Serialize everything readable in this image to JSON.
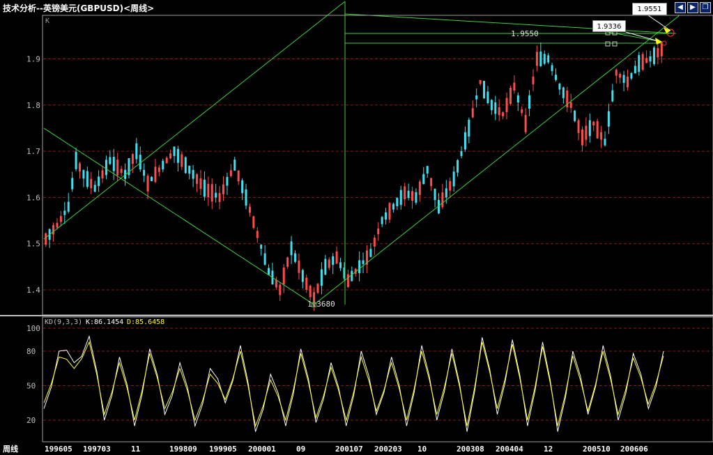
{
  "window": {
    "title": "技术分析--英镑美元(GBPUSD)<周线>"
  },
  "toolbar": {
    "prev_icon": "left-arrow-icon",
    "next_icon": "right-arrow-icon",
    "restore_icon": "restore-window-icon"
  },
  "colors": {
    "up": "#ff4d4d",
    "down": "#40e0f0",
    "trend": "#3fd23f",
    "grid": "#8b1a1a",
    "k_line": "#ffffff",
    "d_line": "#ffff33",
    "axis_text": "#c0c0c0"
  },
  "main_panel": {
    "label": "K"
  },
  "kd_panel": {
    "label": "KD(9,3,3)",
    "k_text": "K:86.1454",
    "d_text": "D:85.6458"
  },
  "annotations": {
    "low_price": "1.3680",
    "high_price": "1.9550",
    "callout_top": "1.9551",
    "callout_mid": "1.9336"
  },
  "period_label": "周线",
  "chart_data": [
    {
      "type": "candlestick",
      "title": "技术分析--英镑美元(GBPUSD)<周线>",
      "ylim": [
        1.34,
        1.99
      ],
      "yticks": [
        "1.4",
        "1.5",
        "1.6",
        "1.7",
        "1.8",
        "1.9"
      ],
      "xticks": [
        "199605",
        "199703",
        "11",
        "199809",
        "199905",
        "200001",
        "09",
        "200107",
        "200203",
        "10",
        "200308",
        "200404",
        "12",
        "200510",
        "200606"
      ],
      "grid": true,
      "close_path": [
        [
          0,
          1.51
        ],
        [
          3,
          1.54
        ],
        [
          6,
          1.58
        ],
        [
          8,
          1.68
        ],
        [
          10,
          1.65
        ],
        [
          13,
          1.62
        ],
        [
          17,
          1.68
        ],
        [
          21,
          1.65
        ],
        [
          24,
          1.7
        ],
        [
          27,
          1.63
        ],
        [
          30,
          1.66
        ],
        [
          34,
          1.7
        ],
        [
          38,
          1.66
        ],
        [
          42,
          1.62
        ],
        [
          46,
          1.6
        ],
        [
          50,
          1.67
        ],
        [
          53,
          1.6
        ],
        [
          56,
          1.52
        ],
        [
          59,
          1.44
        ],
        [
          62,
          1.4
        ],
        [
          65,
          1.49
        ],
        [
          68,
          1.43
        ],
        [
          71,
          1.38
        ],
        [
          74,
          1.45
        ],
        [
          77,
          1.47
        ],
        [
          80,
          1.42
        ],
        [
          83,
          1.45
        ],
        [
          86,
          1.48
        ],
        [
          89,
          1.55
        ],
        [
          92,
          1.58
        ],
        [
          95,
          1.61
        ],
        [
          98,
          1.6
        ],
        [
          101,
          1.66
        ],
        [
          104,
          1.58
        ],
        [
          108,
          1.64
        ],
        [
          112,
          1.75
        ],
        [
          115,
          1.85
        ],
        [
          118,
          1.8
        ],
        [
          121,
          1.78
        ],
        [
          124,
          1.84
        ],
        [
          127,
          1.76
        ],
        [
          130,
          1.9
        ],
        [
          133,
          1.9
        ],
        [
          136,
          1.84
        ],
        [
          139,
          1.8
        ],
        [
          142,
          1.73
        ],
        [
          145,
          1.76
        ],
        [
          148,
          1.72
        ],
        [
          151,
          1.87
        ],
        [
          154,
          1.85
        ],
        [
          157,
          1.89
        ],
        [
          160,
          1.9
        ],
        [
          163,
          1.92
        ]
      ]
    },
    {
      "type": "line",
      "ylim": [
        0,
        100
      ],
      "yticks": [
        "20",
        "50",
        "80",
        "100"
      ],
      "series": [
        {
          "name": "K",
          "swings": [
            30,
            80,
            70,
            93,
            20,
            75,
            15,
            82,
            25,
            70,
            15,
            65,
            35,
            85,
            10,
            60,
            15,
            82,
            18,
            70,
            15,
            80,
            25,
            75,
            15,
            85,
            20,
            82,
            10,
            92,
            25,
            90,
            15,
            88,
            10,
            80,
            25,
            85,
            20,
            78,
            30,
            80
          ]
        },
        {
          "name": "D",
          "swings": [
            35,
            75,
            65,
            88,
            25,
            70,
            20,
            78,
            30,
            65,
            20,
            60,
            38,
            80,
            15,
            55,
            20,
            78,
            22,
            66,
            20,
            75,
            28,
            70,
            20,
            80,
            25,
            78,
            15,
            88,
            30,
            86,
            20,
            84,
            15,
            76,
            28,
            80,
            25,
            74,
            34,
            76
          ]
        }
      ]
    }
  ]
}
